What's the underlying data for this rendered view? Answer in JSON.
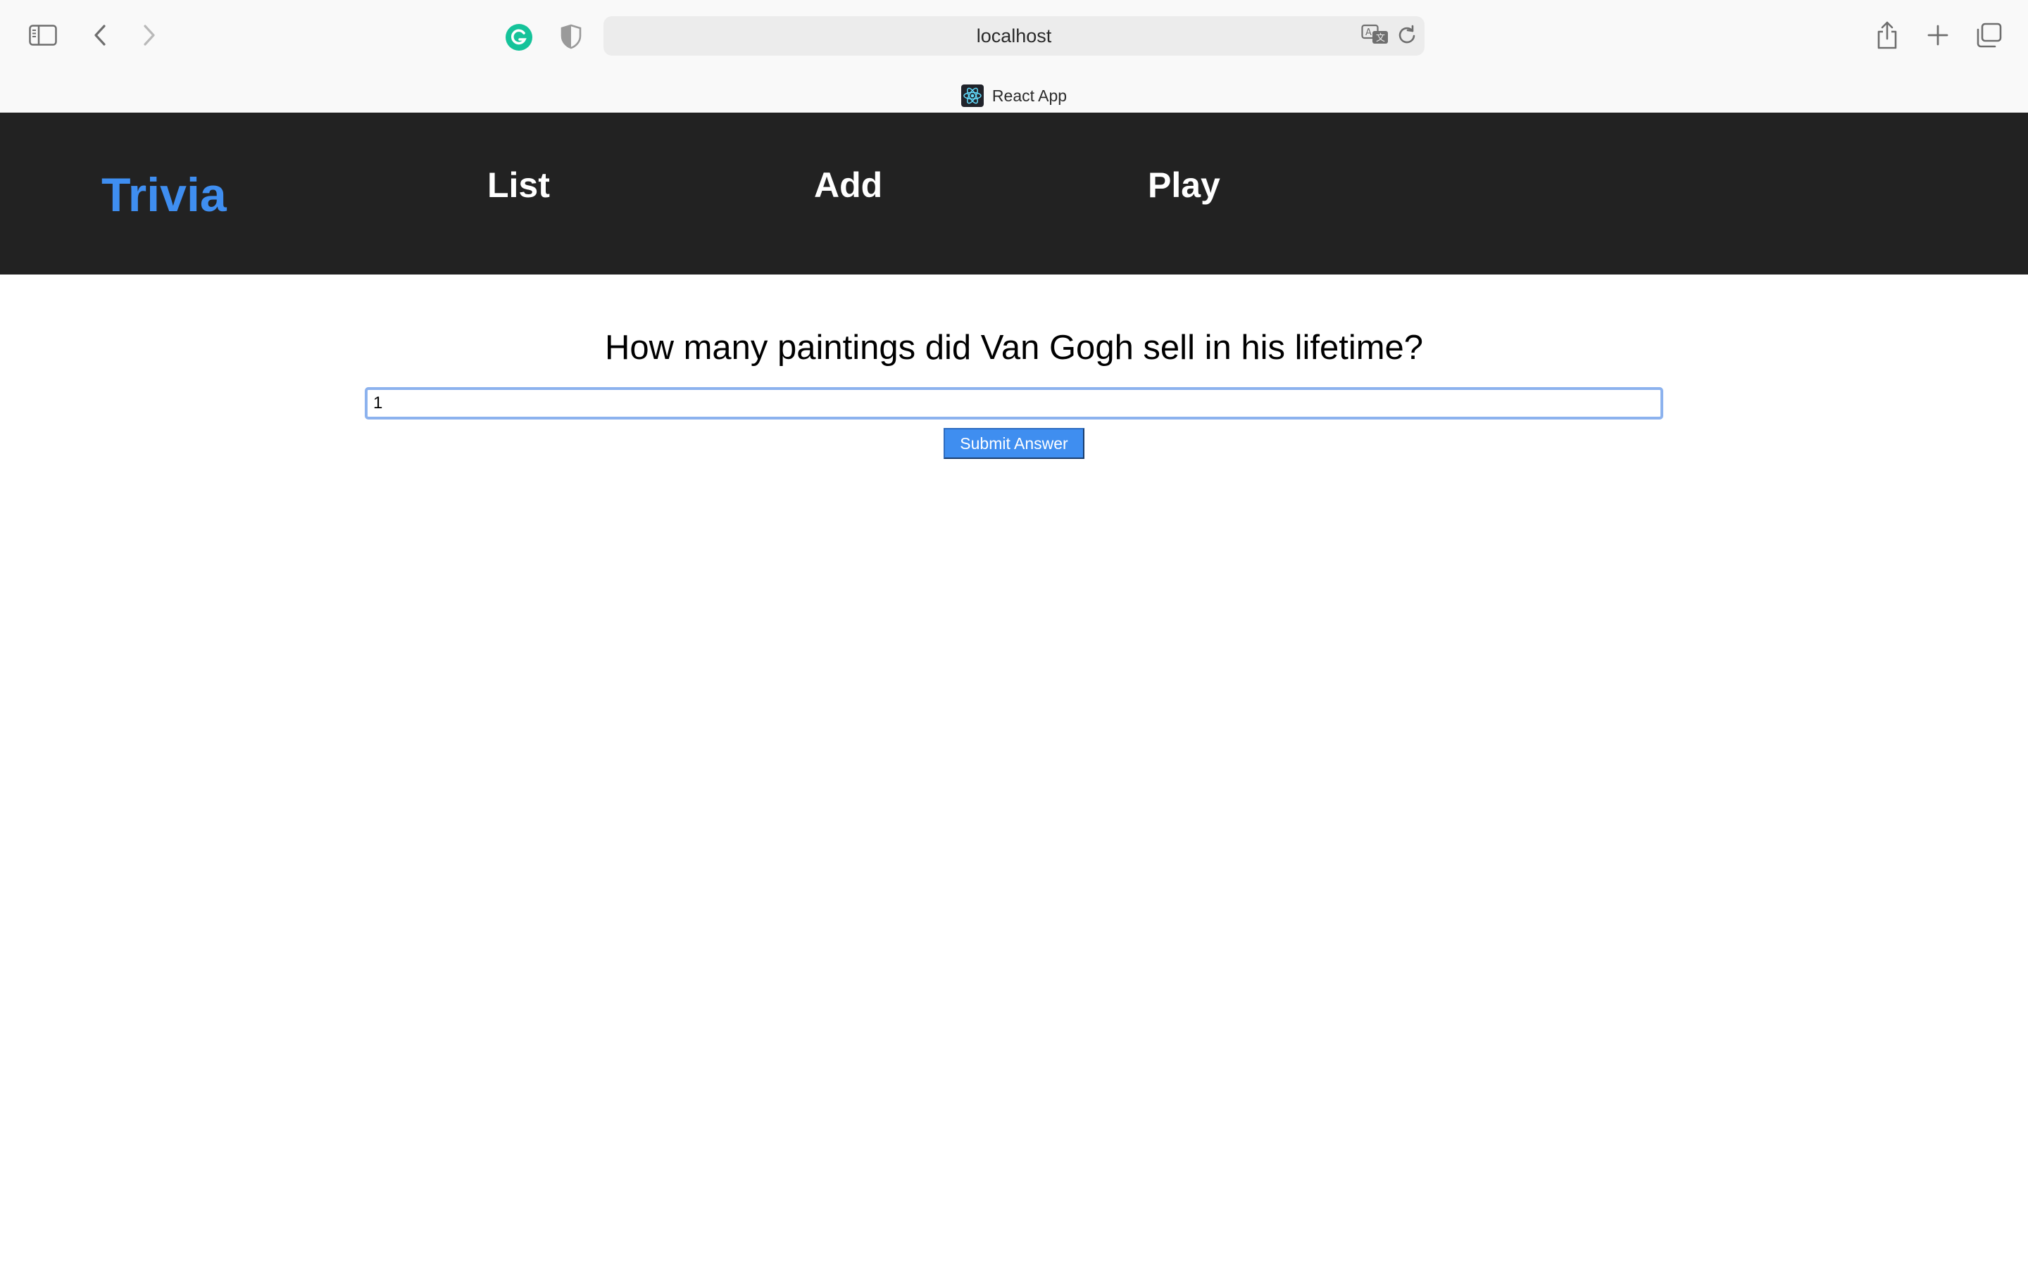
{
  "browser": {
    "address": "localhost",
    "tab_title": "React App",
    "icons": {
      "sidebar": "sidebar-icon",
      "back": "chevron-left-icon",
      "forward": "chevron-right-icon",
      "grammarly": "grammarly-icon",
      "privacy": "shield-icon",
      "translate": "translate-icon",
      "reload": "reload-icon",
      "share": "share-icon",
      "new_tab": "plus-icon",
      "tab_overview": "tabs-icon",
      "favicon": "react-icon"
    }
  },
  "header": {
    "brand": "Trivia",
    "nav": {
      "list": "List",
      "add": "Add",
      "play": "Play"
    }
  },
  "quiz": {
    "question": "How many paintings did Van Gogh sell in his lifetime?",
    "answer_value": "1",
    "submit_label": "Submit Answer"
  },
  "colors": {
    "header_bg": "#222222",
    "brand": "#3f8ef0",
    "accent": "#3f8ef0",
    "input_border": "#8cb2ee",
    "chrome_bg": "#f9f9f9"
  }
}
